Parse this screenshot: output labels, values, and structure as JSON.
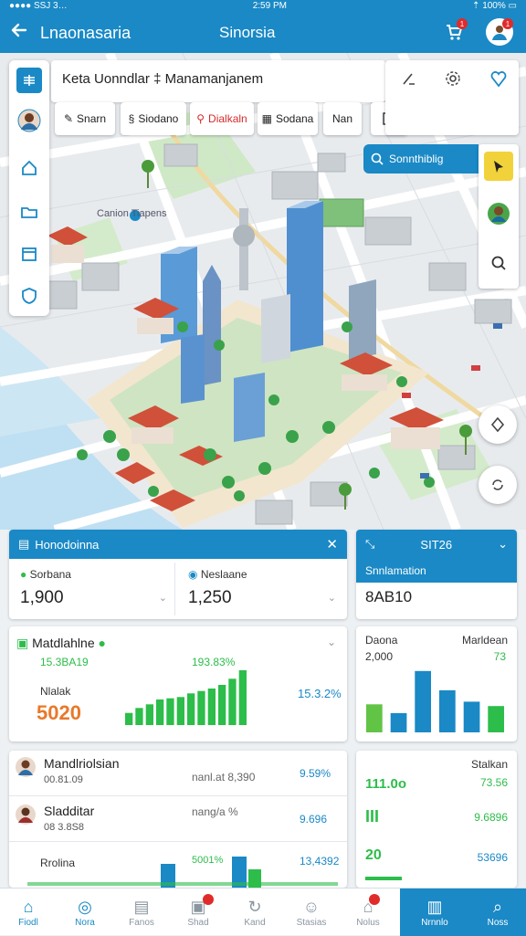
{
  "status": {
    "left": "●●●● SSJ 3…",
    "time": "2:59 PM",
    "right": "⇡ 100% ▭"
  },
  "header": {
    "back_icon": "back-arrow-icon",
    "title": "Lnaonasaria",
    "center_title": "Sinorsia",
    "cart_badge": "1",
    "profile_badge": "1"
  },
  "map": {
    "title_text": "Keta Uonndlar ‡   Manamanjanem",
    "chips": [
      {
        "icon": "magic",
        "label": "Snarn",
        "color": "#222222"
      },
      {
        "icon": "stack",
        "label": "Siodano",
        "color": "#222222"
      },
      {
        "icon": "pin",
        "label": "Dialkaln",
        "color": "#d62b2b"
      },
      {
        "icon": "grid",
        "label": "Sodana",
        "color": "#222222"
      },
      {
        "icon": "",
        "label": "Nan",
        "color": "#222222"
      }
    ],
    "search_label": "Sonnthiblig",
    "place_label": "Canion  Tiapens",
    "accent": "#1a89c6"
  },
  "panel1": {
    "title": "Honodoinna",
    "cards": [
      {
        "label": "Sorbana",
        "value": "1,900"
      },
      {
        "label": "Neslaane",
        "value": "1,250"
      }
    ]
  },
  "panel2": {
    "title": "SIT26",
    "subtitle": "Snnlamation",
    "value": "8AB10"
  },
  "panel3": {
    "title": "Matdlahlne",
    "stat_left": "15.3BA19",
    "stat_right": "193.83%",
    "label": "Nlalak",
    "big_value": "5020",
    "delta": "15.3.2%",
    "bars": [
      10,
      14,
      17,
      21,
      22,
      23,
      26,
      28,
      30,
      33,
      38,
      45
    ]
  },
  "panel4": {
    "left_label": "Daona",
    "right_label": "Marldean",
    "value": "2,000",
    "delta": "73",
    "bars": [
      {
        "v": 32,
        "color": "#61c445"
      },
      {
        "v": 22,
        "color": "#1a89c6"
      },
      {
        "v": 70,
        "color": "#1a89c6"
      },
      {
        "v": 48,
        "color": "#1a89c6"
      },
      {
        "v": 35,
        "color": "#1a89c6"
      },
      {
        "v": 30,
        "color": "#2dbd4a"
      }
    ]
  },
  "panel5": {
    "rows": [
      {
        "name": "Mandlriolsian",
        "sub": "00.81.09",
        "mid": "nanl.at 8,390",
        "right": "9.59%"
      },
      {
        "name": "Sladditar",
        "sub": "08 3.8S8",
        "mid": "nang/a %",
        "right": "9.696"
      },
      {
        "name": "Rrolina",
        "sub": "",
        "mid": "5001%",
        "right": "13,4392"
      }
    ]
  },
  "panel6": {
    "title": "Stalkan",
    "rows": [
      {
        "left": "111.0o",
        "right": "73.56"
      },
      {
        "left": "III",
        "right": "9.6896"
      },
      {
        "left": "20",
        "right": "53696"
      }
    ]
  },
  "nav": [
    {
      "label": "Fiodl",
      "icon": "home-icon"
    },
    {
      "label": "Nora",
      "icon": "compass-icon"
    },
    {
      "label": "Fanos",
      "icon": "document-icon"
    },
    {
      "label": "Shad",
      "icon": "clipboard-icon"
    },
    {
      "label": "Kand",
      "icon": "refresh-icon"
    },
    {
      "label": "Stasias",
      "icon": "user-icon"
    },
    {
      "label": "Nolus",
      "icon": "house-icon"
    },
    {
      "label": "Nrnnlo",
      "icon": "building-icon"
    },
    {
      "label": "Noss",
      "icon": "search-icon"
    }
  ]
}
